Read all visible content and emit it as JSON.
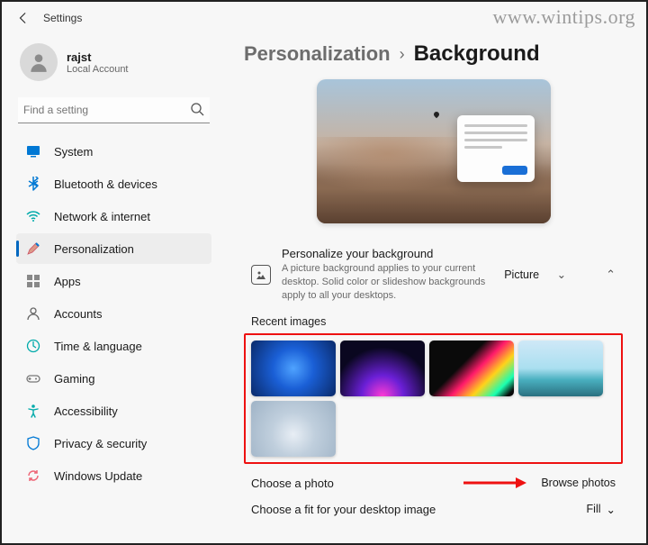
{
  "app": {
    "title": "Settings"
  },
  "user": {
    "name": "rajst",
    "sub": "Local Account"
  },
  "search": {
    "placeholder": "Find a setting"
  },
  "nav": {
    "items": [
      {
        "label": "System"
      },
      {
        "label": "Bluetooth & devices"
      },
      {
        "label": "Network & internet"
      },
      {
        "label": "Personalization"
      },
      {
        "label": "Apps"
      },
      {
        "label": "Accounts"
      },
      {
        "label": "Time & language"
      },
      {
        "label": "Gaming"
      },
      {
        "label": "Accessibility"
      },
      {
        "label": "Privacy & security"
      },
      {
        "label": "Windows Update"
      }
    ]
  },
  "breadcrumb": {
    "parent": "Personalization",
    "sep": "›",
    "current": "Background"
  },
  "personalize": {
    "title": "Personalize your background",
    "desc": "A picture background applies to your current desktop. Solid color or slideshow backgrounds apply to all your desktops.",
    "value": "Picture"
  },
  "recent": {
    "label": "Recent images"
  },
  "choose_photo": {
    "label": "Choose a photo",
    "button": "Browse photos"
  },
  "fit": {
    "label": "Choose a fit for your desktop image",
    "value": "Fill"
  },
  "watermark": "www.wintips.org"
}
